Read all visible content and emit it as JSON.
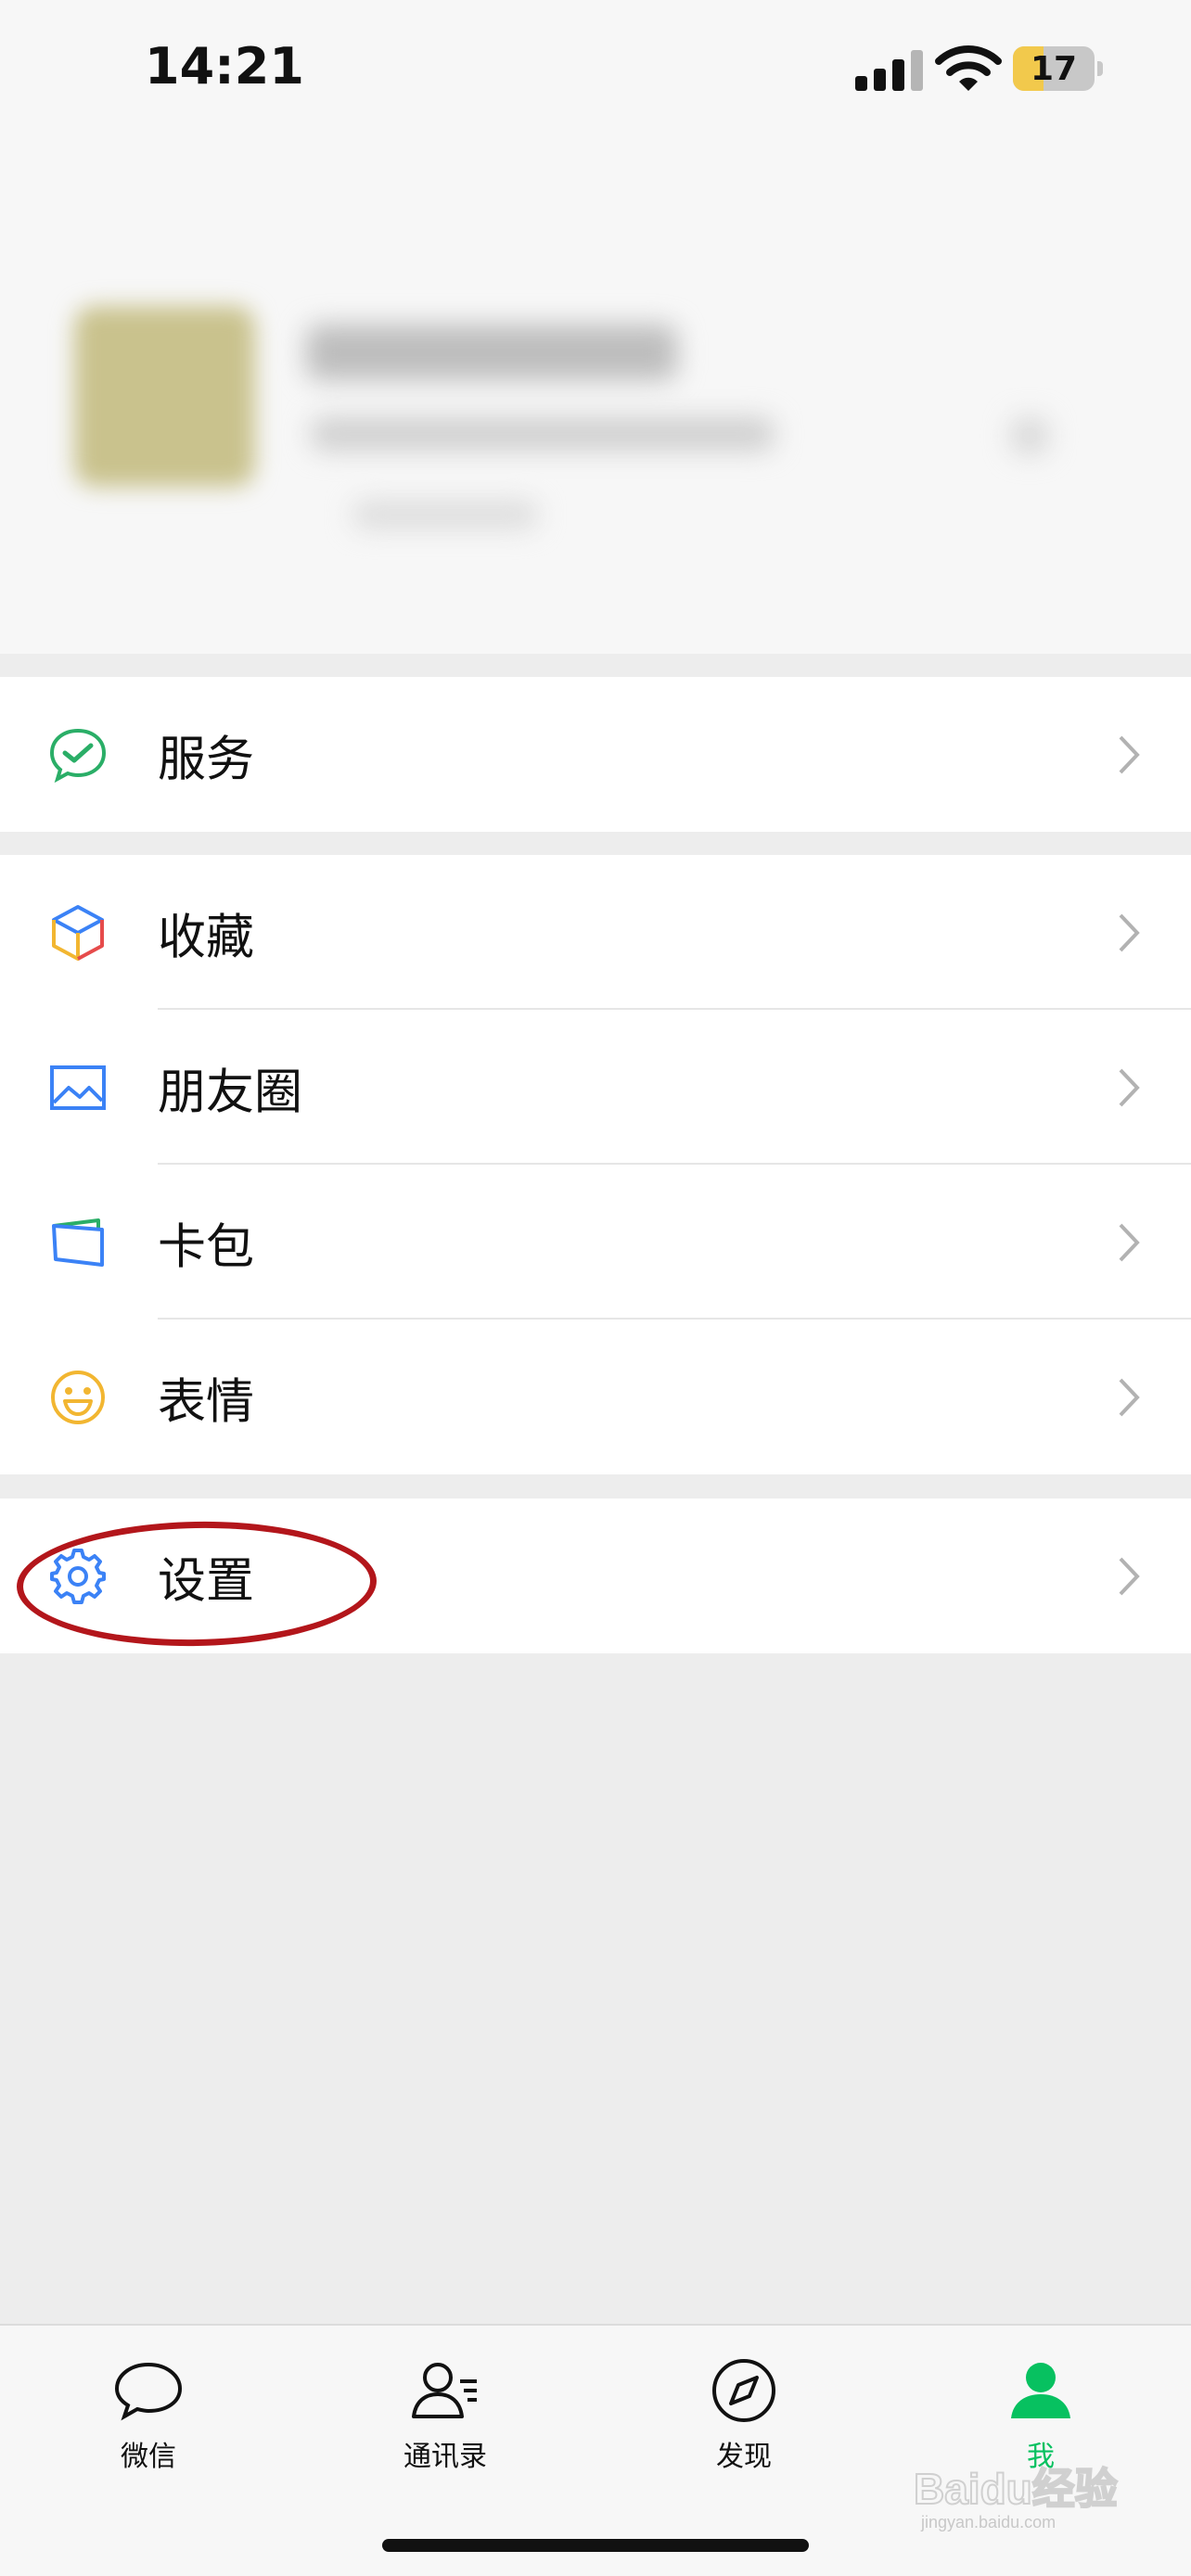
{
  "status_bar": {
    "time": "14:21",
    "battery": "17",
    "battery_level": 0.17
  },
  "menu": {
    "services": {
      "label": "服务",
      "icon": "wechat-pay-check-icon"
    },
    "favorites": {
      "label": "收藏",
      "icon": "cube-icon"
    },
    "moments": {
      "label": "朋友圈",
      "icon": "photo-icon"
    },
    "cards": {
      "label": "卡包",
      "icon": "card-wallet-icon"
    },
    "stickers": {
      "label": "表情",
      "icon": "smiley-icon"
    },
    "settings": {
      "label": "设置",
      "icon": "gear-icon"
    }
  },
  "tabbar": {
    "tabs": [
      {
        "label": "微信",
        "icon": "chat-bubble-icon",
        "active": false
      },
      {
        "label": "通讯录",
        "icon": "contacts-icon",
        "active": false
      },
      {
        "label": "发现",
        "icon": "compass-icon",
        "active": false
      },
      {
        "label": "我",
        "icon": "person-icon",
        "active": true
      }
    ]
  },
  "watermark": {
    "text": "Baidu经验",
    "subtext": "jingyan.baidu.com"
  },
  "colors": {
    "accent_green": "#07c160",
    "annotation_red": "#b3161b",
    "background": "#ededed"
  }
}
